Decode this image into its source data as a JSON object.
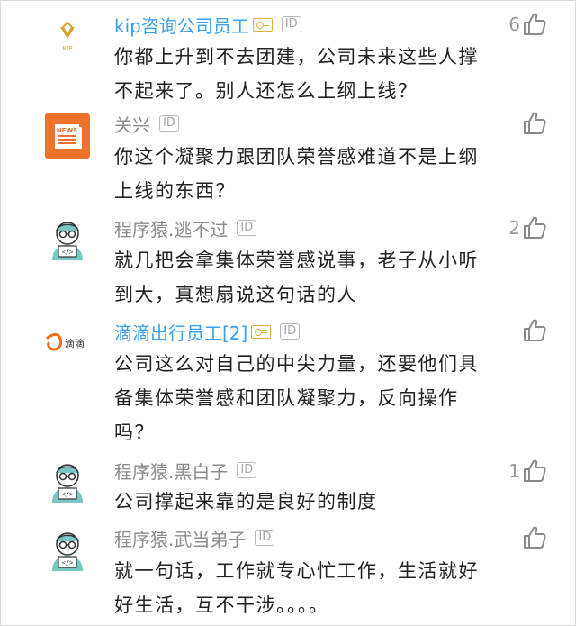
{
  "comments": [
    {
      "name": "kip咨询公司员工",
      "id_badge": "ID",
      "text": "你都上升到不去团建，公司未来这些人撑不起来了。别人还怎么上纲上线？",
      "likes": "6",
      "avatar_label": "KIP",
      "vip": true
    },
    {
      "name": "关兴",
      "id_badge": "ID",
      "text": "你这个凝聚力跟团队荣誉感难道不是上纲上线的东西？",
      "likes": "",
      "avatar_label": "NEWS",
      "vip": false
    },
    {
      "name": "程序猿.逃不过",
      "id_badge": "ID",
      "text": "就几把会拿集体荣誉感说事，老子从小听到大，真想扇说这句话的人",
      "likes": "2",
      "avatar_label": "</>",
      "vip": false
    },
    {
      "name": "滴滴出行员工[2]",
      "id_badge": "ID",
      "text": "公司这么对自己的中尖力量，还要他们具备集体荣誉感和团队凝聚力，反向操作吗？",
      "likes": "",
      "avatar_label": "滴滴",
      "vip": true
    },
    {
      "name": "程序猿.黑白子",
      "id_badge": "ID",
      "text": "公司撑起来靠的是良好的制度",
      "likes": "1",
      "avatar_label": "</>",
      "vip": false
    },
    {
      "name": "程序猿.武当弟子",
      "id_badge": "ID",
      "text": "就一句话，工作就专心忙工作，生活就好好生活，互不干涉。。。。",
      "likes": "",
      "avatar_label": "</>",
      "vip": false
    }
  ],
  "colors": {
    "vip_name": "#3aa0f0",
    "plain_name": "#8c8c8c",
    "text": "#222222",
    "kip_gold": "#d4a52a",
    "news_orange": "#f0712a",
    "didi_orange": "#f26b1d",
    "coder_teal": "#79c7c4"
  }
}
